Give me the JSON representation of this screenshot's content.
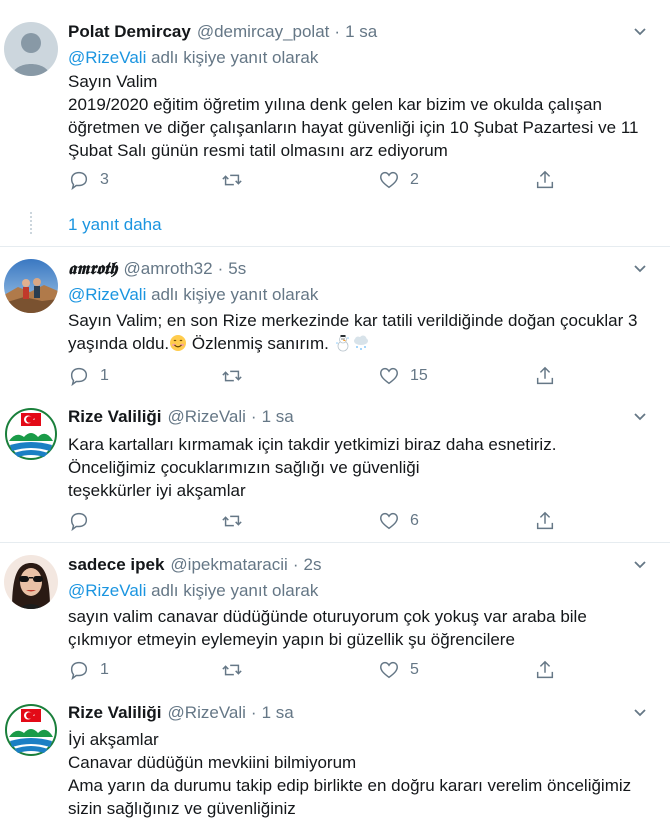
{
  "tweets": [
    {
      "name": "Polat Demircay",
      "handle": "@demircay_polat",
      "dot": "·",
      "time": "1 sa",
      "reply_mention": "@RizeVali",
      "reply_suffix": " adlı kişiye yanıt olarak",
      "lines": [
        "Sayın Valim",
        "2019/2020 eğitim öğretim yılına denk gelen kar bizim ve okulda çalışan",
        "öğretmen ve diğer çalışanların hayat güvenliği için 10 Şubat Pazartesi ve 11",
        "Şubat Salı günün resmi tatil olmasını arz ediyorum"
      ],
      "replies": "3",
      "retweets": "",
      "likes": "2",
      "more_replies": "1 yanıt daha",
      "avatar": "default-avatar"
    },
    {
      "name": "𝖆𝖒𝖗𝖔𝖙𝖍",
      "handle": "@amroth32",
      "dot": "·",
      "time": "5s",
      "reply_mention": "@RizeVali",
      "reply_suffix": " adlı kişiye yanıt olarak",
      "line1": "Sayın Valim; en son Rize merkezinde kar tatili verildiğinde doğan çocuklar 3",
      "line2": "yaşında oldu.",
      "line2b": " Özlenmiş sanırım. ",
      "replies": "1",
      "retweets": "",
      "likes": "15",
      "avatar": "photo-avatar"
    },
    {
      "name": "Rize Valiliği",
      "handle": "@RizeVali",
      "dot": "·",
      "time": "1 sa",
      "lines": [
        "Kara kartalları kırmamak için takdir yetkimizi biraz daha esnetiriz.",
        "Önceliğimiz çocuklarımızın sağlığı ve güvenliği",
        "teşekkürler iyi akşamlar"
      ],
      "replies": "",
      "retweets": "",
      "likes": "6",
      "avatar": "rize-logo"
    },
    {
      "name": "sadece ipek",
      "handle": "@ipekmataracii",
      "dot": "·",
      "time": "2s",
      "reply_mention": "@RizeVali",
      "reply_suffix": " adlı kişiye yanıt olarak",
      "lines": [
        "sayın valim canavar düdüğünde oturuyorum çok yokuş var araba bile",
        "çıkmıyor etmeyin eylemeyin yapın bi güzellik şu öğrencilere"
      ],
      "replies": "1",
      "retweets": "",
      "likes": "5",
      "avatar": "photo-avatar"
    },
    {
      "name": "Rize Valiliği",
      "handle": "@RizeVali",
      "dot": "·",
      "time": "1 sa",
      "lines": [
        "İyi akşamlar",
        "Canavar düdüğün mevkiini bilmiyorum",
        "Ama yarın da durumu takip edip birlikte en doğru kararı verelim önceliğimiz",
        "sizin sağlığınız ve güvenliğiniz"
      ],
      "avatar": "rize-logo"
    }
  ],
  "colors": {
    "text": "#14171a",
    "secondary": "#657786",
    "link": "#1b95e0",
    "divider": "#e6ecf0"
  }
}
